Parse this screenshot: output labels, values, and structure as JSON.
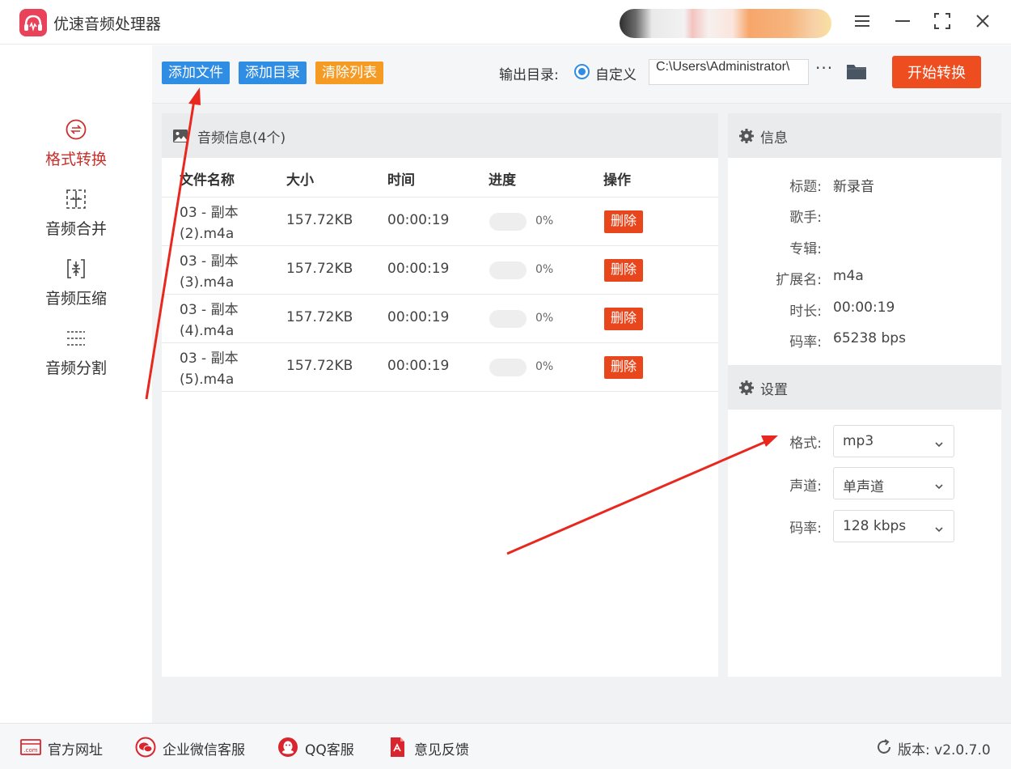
{
  "app": {
    "title": "优速音频处理器"
  },
  "sidebar": {
    "items": [
      {
        "label": "格式转换",
        "active": true
      },
      {
        "label": "音频合并",
        "active": false
      },
      {
        "label": "音频压缩",
        "active": false
      },
      {
        "label": "音频分割",
        "active": false
      }
    ]
  },
  "toolbar": {
    "add_file": "添加文件",
    "add_dir": "添加目录",
    "clear_list": "清除列表",
    "output_label": "输出目录:",
    "radio_label": "自定义",
    "output_path": "C:\\Users\\Administrator\\",
    "more": "···",
    "start": "开始转换"
  },
  "list": {
    "title": "音频信息(4个)",
    "columns": {
      "name": "文件名称",
      "size": "大小",
      "time": "时间",
      "progress": "进度",
      "action": "操作"
    },
    "rows": [
      {
        "name_line1": "03 - 副本",
        "name_line2": "(2).m4a",
        "size": "157.72KB",
        "time": "00:00:19",
        "progress_value": 0,
        "progress": "0%",
        "action": "删除"
      },
      {
        "name_line1": "03 - 副本",
        "name_line2": "(3).m4a",
        "size": "157.72KB",
        "time": "00:00:19",
        "progress_value": 0,
        "progress": "0%",
        "action": "删除"
      },
      {
        "name_line1": "03 - 副本",
        "name_line2": "(4).m4a",
        "size": "157.72KB",
        "time": "00:00:19",
        "progress_value": 0,
        "progress": "0%",
        "action": "删除"
      },
      {
        "name_line1": "03 - 副本",
        "name_line2": "(5).m4a",
        "size": "157.72KB",
        "time": "00:00:19",
        "progress_value": 0,
        "progress": "0%",
        "action": "删除"
      }
    ]
  },
  "info": {
    "title": "信息",
    "fields": [
      {
        "label": "标题:",
        "value": "新录音"
      },
      {
        "label": "歌手:",
        "value": ""
      },
      {
        "label": "专辑:",
        "value": ""
      },
      {
        "label": "扩展名:",
        "value": "m4a"
      },
      {
        "label": "时长:",
        "value": "00:00:19"
      },
      {
        "label": "码率:",
        "value": "65238 bps"
      }
    ]
  },
  "settings": {
    "title": "设置",
    "format_label": "格式:",
    "format_value": "mp3",
    "channel_label": "声道:",
    "channel_value": "单声道",
    "bitrate_label": "码率:",
    "bitrate_value": "128 kbps"
  },
  "footer": {
    "website": "官方网址",
    "wechat": "企业微信客服",
    "qq": "QQ客服",
    "feedback": "意见反馈",
    "version": "版本: v2.0.7.0"
  },
  "colors": {
    "accent_blue": "#2f8de4",
    "accent_orange": "#f59a23",
    "danger_red": "#e8471d",
    "active_nav": "#c9302c"
  }
}
